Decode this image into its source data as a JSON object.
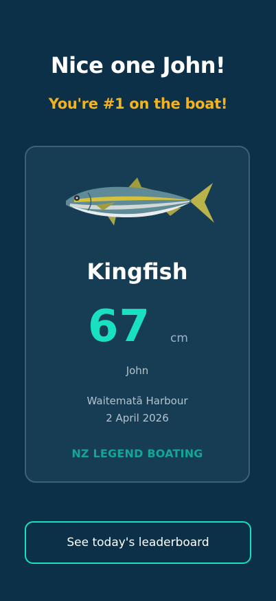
{
  "header": {
    "title": "Nice one John!",
    "subtitle": "You're #1 on the boat!"
  },
  "catch_card": {
    "fish_icon": "kingfish-illustration",
    "species": "Kingfish",
    "length_value": "67",
    "length_unit": "cm",
    "angler": "John",
    "location": "Waitematā Harbour",
    "date": "2 April 2026",
    "brand": "NZ LEGEND BOATING"
  },
  "actions": {
    "leaderboard_label": "See today's leaderboard"
  },
  "colors": {
    "background": "#0c3048",
    "card": "#173d55",
    "accent_yellow": "#f2b31e",
    "accent_teal": "#19e0c0",
    "brand_teal": "#14a594"
  }
}
